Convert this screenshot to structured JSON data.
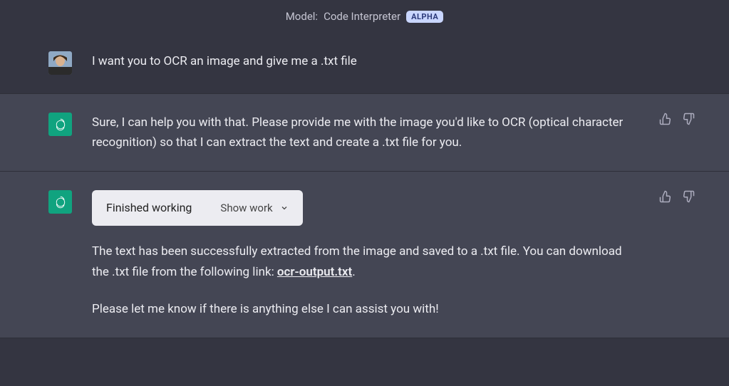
{
  "header": {
    "model_prefix": "Model:",
    "model_name": "Code Interpreter",
    "badge": "ALPHA"
  },
  "messages": {
    "user1": "I want you to OCR an image and give me a .txt file",
    "assistant1": "Sure, I can help you with that. Please provide me with the image you'd like to OCR (optical character recognition) so that I can extract the text and create a .txt file for you.",
    "assistant2_work_status": "Finished working",
    "assistant2_show_work": "Show work",
    "assistant2_p1_a": "The text has been successfully extracted from the image and saved to a .txt file. You can download the .txt file from the following link: ",
    "assistant2_link": "ocr-output.txt",
    "assistant2_p1_b": ".",
    "assistant2_p2": "Please let me know if there is anything else I can assist you with!"
  }
}
